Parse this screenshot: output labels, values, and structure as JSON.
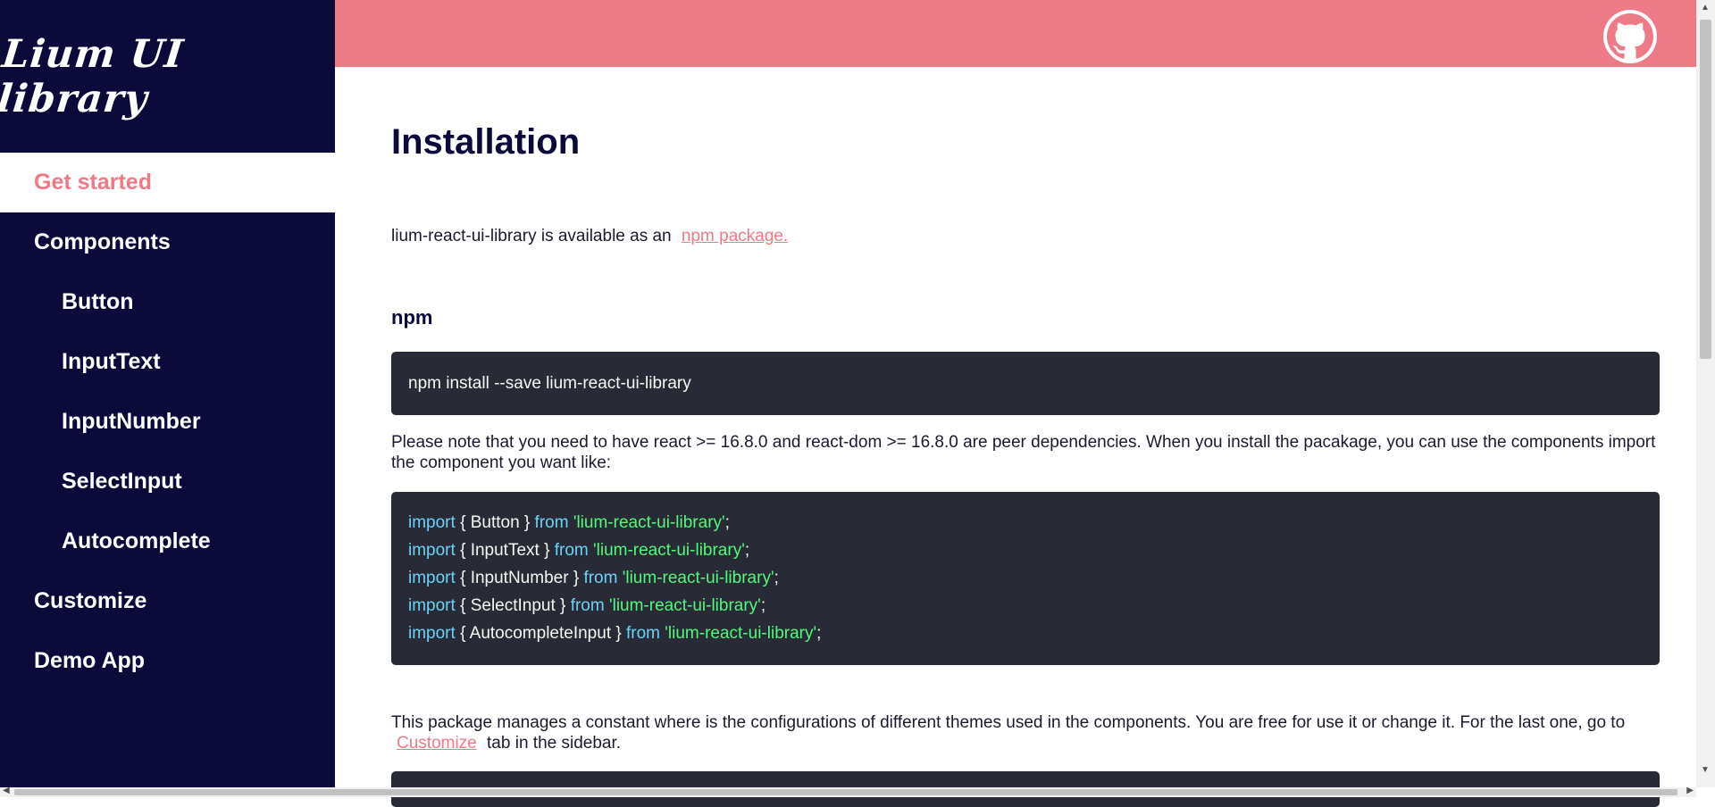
{
  "sidebar": {
    "logo": "Lium UI library",
    "items": [
      {
        "label": "Get started"
      },
      {
        "label": "Components"
      },
      {
        "label": "Button"
      },
      {
        "label": "InputText"
      },
      {
        "label": "InputNumber"
      },
      {
        "label": "SelectInput"
      },
      {
        "label": "Autocomplete"
      },
      {
        "label": "Customize"
      },
      {
        "label": "Demo App"
      }
    ]
  },
  "topbar": {
    "icon": "github-icon"
  },
  "main": {
    "title": "Installation",
    "intro_text": "lium-react-ui-library is available as an",
    "intro_link": "npm package.",
    "npm_heading": "npm",
    "install_command": "npm install --save lium-react-ui-library",
    "peer_note": "Please note that you need to have react >= 16.8.0 and react-dom >= 16.8.0 are peer dependencies. When you install the pacakage, you can use the components import the component you want like:",
    "imports": [
      {
        "kw": "import",
        "body": "{ Button }",
        "from": "from",
        "str": "'lium-react-ui-library'",
        "end": ";"
      },
      {
        "kw": "import",
        "body": "{ InputText }",
        "from": "from",
        "str": "'lium-react-ui-library'",
        "end": ";"
      },
      {
        "kw": "import",
        "body": "{ InputNumber }",
        "from": "from",
        "str": "'lium-react-ui-library'",
        "end": ";"
      },
      {
        "kw": "import",
        "body": "{ SelectInput }",
        "from": "from",
        "str": "'lium-react-ui-library'",
        "end": ";"
      },
      {
        "kw": "import",
        "body": "{ AutocompleteInput }",
        "from": "from",
        "str": "'lium-react-ui-library'",
        "end": ";"
      }
    ],
    "theme_text_1": "This package manages a constant where is the configurations of different themes used in the components. You are free for use it or change it. For the last one, go to",
    "theme_link": "Customize",
    "theme_text_2": "tab in the sidebar."
  },
  "colors": {
    "sidebar_bg": "#0b0a3b",
    "accent": "#ed7a84",
    "code_bg": "#282a36",
    "code_keyword": "#6cd3f4",
    "code_string": "#50fa7b"
  }
}
